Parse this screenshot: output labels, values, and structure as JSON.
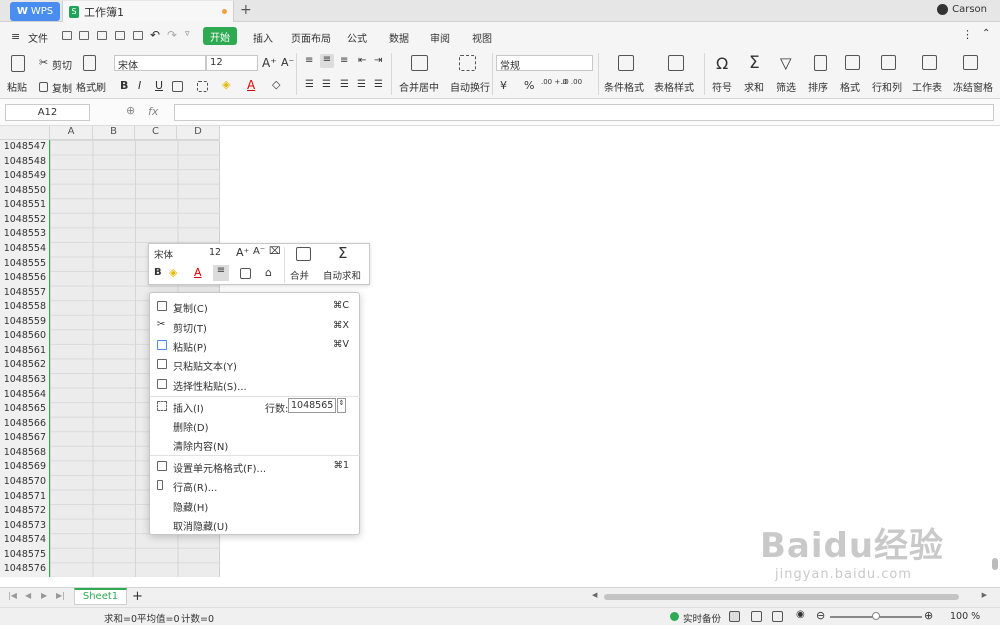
{
  "titlebar": {
    "wps_label": "WPS",
    "workbook_tab": "工作簿1",
    "new_tab": "+",
    "user": "Carson"
  },
  "menubar": {
    "file": "文件",
    "tabs": [
      "开始",
      "插入",
      "页面布局",
      "公式",
      "数据",
      "审阅",
      "视图"
    ]
  },
  "ribbon": {
    "paste": "粘贴",
    "cut": "剪切",
    "copy": "复制",
    "format_painter": "格式刷",
    "font_name": "宋体",
    "font_size": "12",
    "bold": "B",
    "italic": "I",
    "underline": "U",
    "merge_center": "合并居中",
    "wrap_text": "自动换行",
    "number_format": "常规",
    "conditional_format": "条件格式",
    "table_style": "表格样式",
    "symbol": "符号",
    "sum": "求和",
    "filter": "筛选",
    "sort": "排序",
    "format": "格式",
    "row_col": "行和列",
    "worksheet": "工作表",
    "freeze": "冻结窗格",
    "percent": "%",
    "decimal_inc": ".00 +.0",
    "decimal_dec": ".0 .00"
  },
  "formula_bar": {
    "cell_ref": "A12",
    "fx": "fx"
  },
  "columns": [
    "A",
    "B",
    "C",
    "D"
  ],
  "rows": [
    "1048547",
    "1048548",
    "1048549",
    "1048550",
    "1048551",
    "1048552",
    "1048553",
    "1048554",
    "1048555",
    "1048556",
    "1048557",
    "1048558",
    "1048559",
    "1048560",
    "1048561",
    "1048562",
    "1048563",
    "1048564",
    "1048565",
    "1048566",
    "1048567",
    "1048568",
    "1048569",
    "1048570",
    "1048571",
    "1048572",
    "1048573",
    "1048574",
    "1048575",
    "1048576"
  ],
  "mini_toolbar": {
    "font": "宋体",
    "size": "12",
    "merge": "合并",
    "autosum": "自动求和",
    "bold": "B",
    "font_color": "A"
  },
  "context_menu": {
    "copy": "复制(C)",
    "copy_sc": "⌘C",
    "cut": "剪切(T)",
    "cut_sc": "⌘X",
    "paste": "粘贴(P)",
    "paste_sc": "⌘V",
    "paste_text": "只粘贴文本(Y)",
    "paste_special": "选择性粘贴(S)...",
    "insert": "插入(I)",
    "rows_label": "行数:",
    "rows_value": "1048565",
    "delete": "删除(D)",
    "clear": "清除内容(N)",
    "format_cells": "设置单元格格式(F)...",
    "format_sc": "⌘1",
    "row_height": "行高(R)...",
    "hide": "隐藏(H)",
    "unhide": "取消隐藏(U)"
  },
  "sheets": {
    "active": "Sheet1",
    "add": "+"
  },
  "status": {
    "sum": "求和=0",
    "avg": "平均值=0",
    "count": "计数=0",
    "backup": "实时备份",
    "zoom": "100 %"
  },
  "watermark": {
    "logo": "Baidu经验",
    "url": "jingyan.baidu.com"
  }
}
